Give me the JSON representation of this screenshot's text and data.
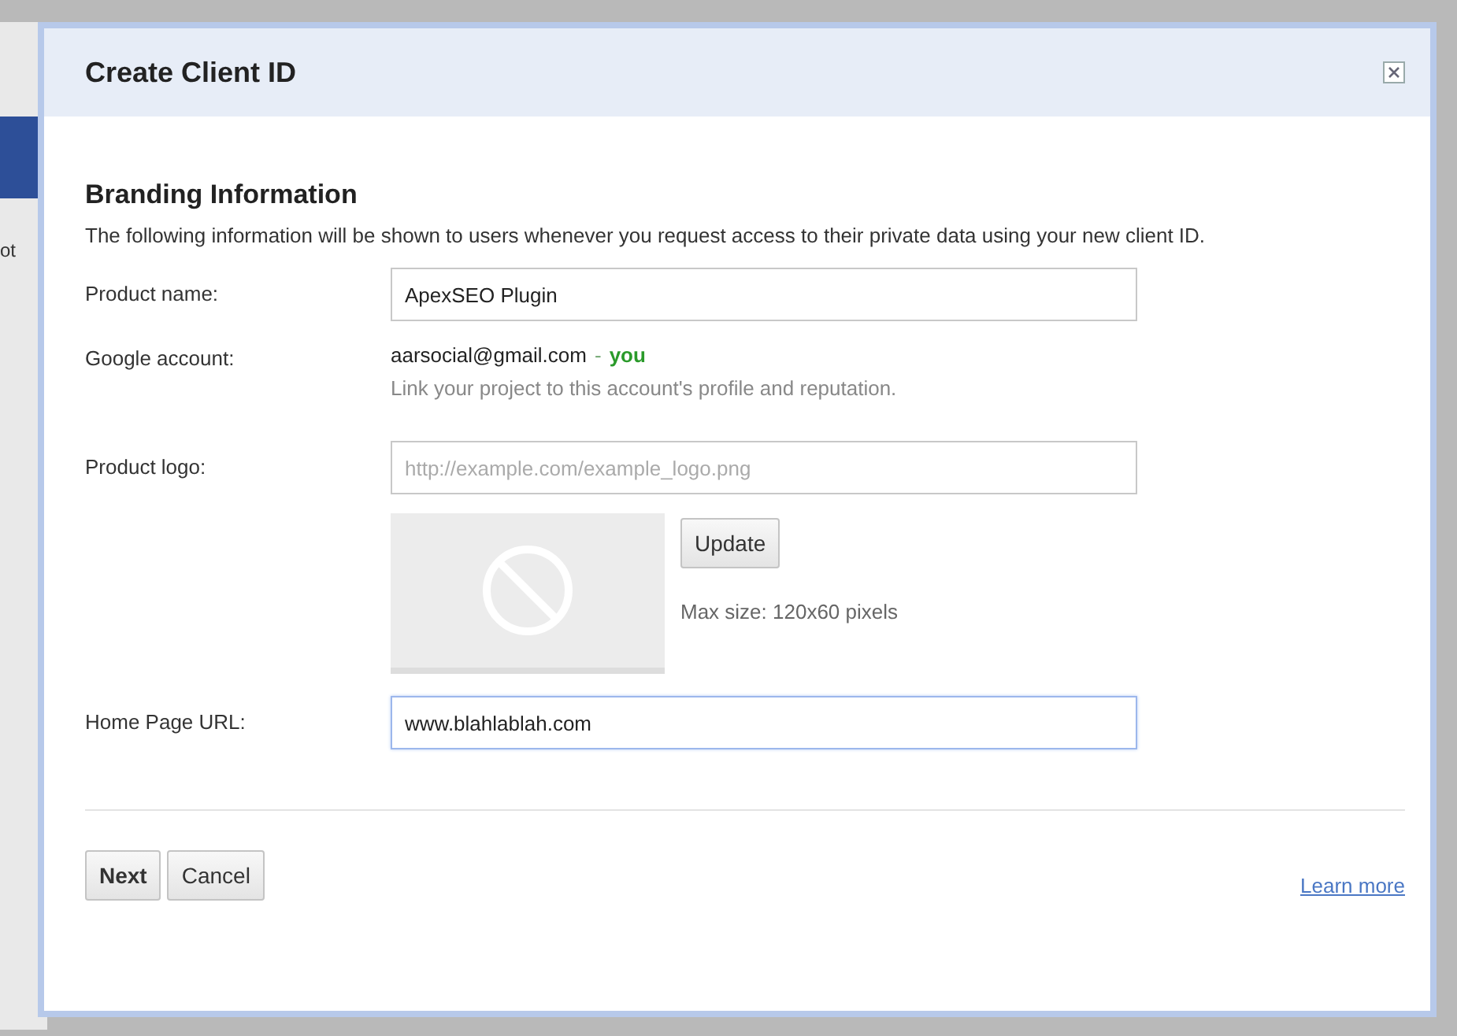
{
  "background": {
    "fragment": "ot"
  },
  "dialog": {
    "title": "Create Client ID",
    "heading": "Branding Information",
    "description": "The following information will be shown to users whenever you request access to their private data using your new client ID.",
    "fields": [
      {
        "kind": "input",
        "label": "Product name:",
        "value": "ApexSEO Plugin",
        "focused": false
      },
      {
        "kind": "account",
        "label": "Google account:",
        "email": "aarsocial@gmail.com",
        "separator": "-",
        "you": "you",
        "hint": "Link your project to this account's profile and reputation."
      },
      {
        "kind": "logo",
        "label": "Product logo:",
        "placeholder": "http://example.com/example_logo.png",
        "button": "Update",
        "note": "Max size: 120x60 pixels"
      },
      {
        "kind": "input",
        "label": "Home Page URL:",
        "value": "www.blahlablah.com",
        "focused": true
      }
    ],
    "buttons": [
      "Next",
      "Cancel"
    ],
    "link": "Learn more"
  }
}
